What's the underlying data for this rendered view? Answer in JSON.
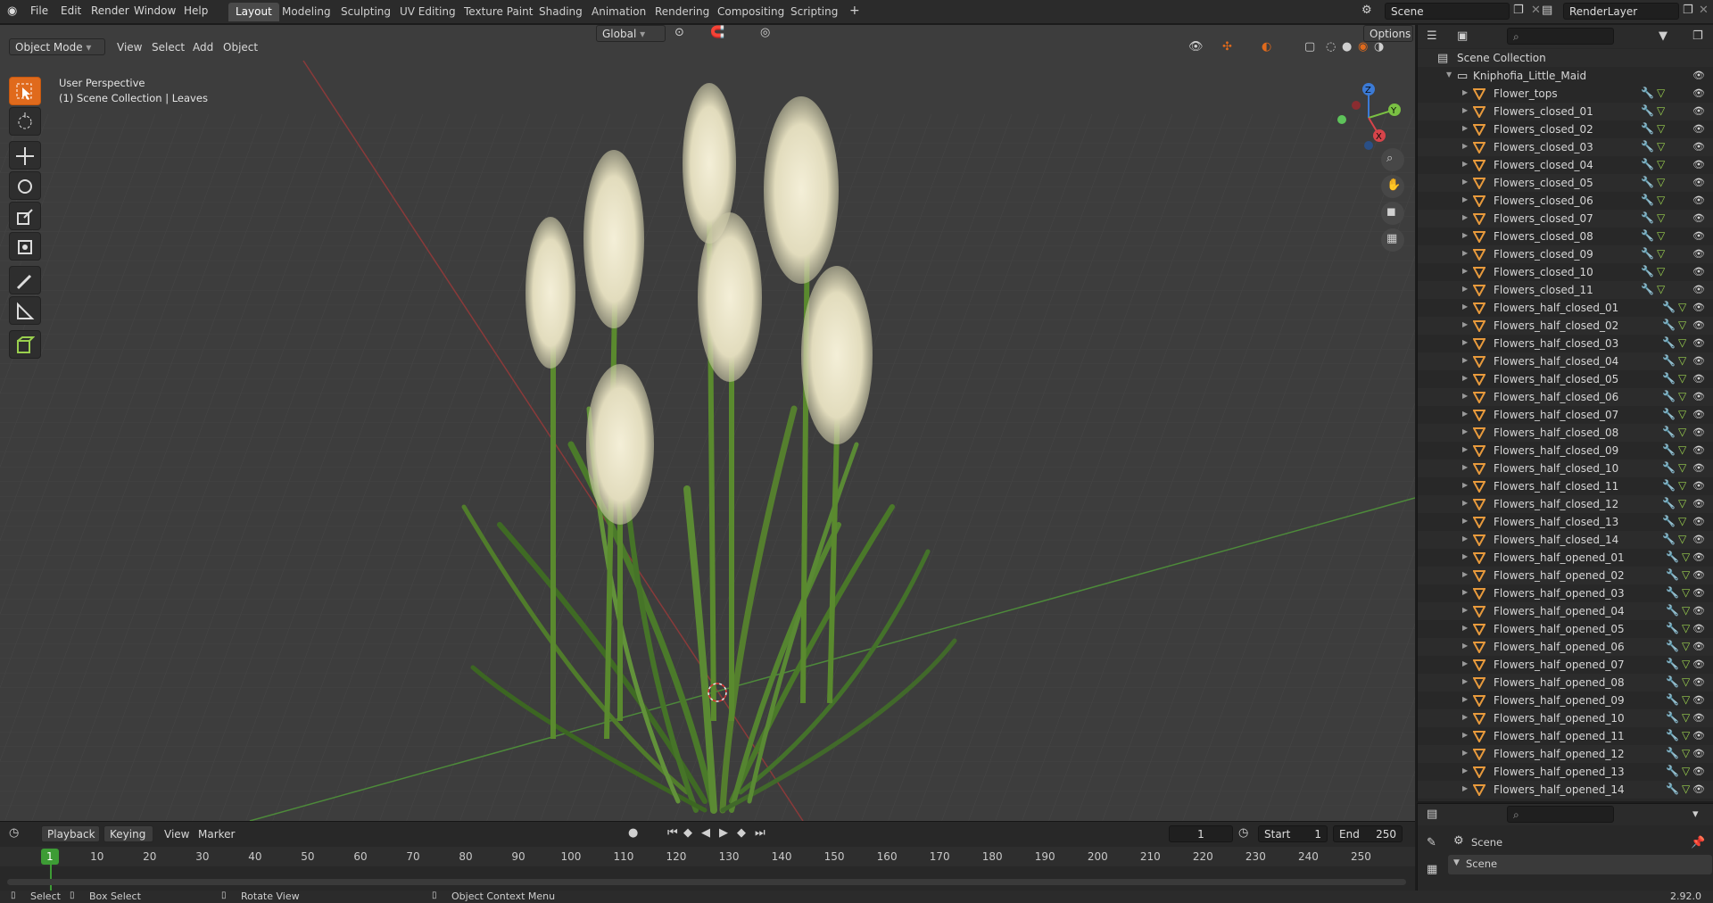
{
  "topbar": {
    "menus": [
      "File",
      "Edit",
      "Render",
      "Window",
      "Help"
    ],
    "workspaces": [
      "Layout",
      "Modeling",
      "Sculpting",
      "UV Editing",
      "Texture Paint",
      "Shading",
      "Animation",
      "Rendering",
      "Compositing",
      "Scripting"
    ],
    "active_workspace": "Layout",
    "add_tab": "+",
    "scene_name": "Scene",
    "render_layer": "RenderLayer"
  },
  "viewport_header": {
    "mode": "Object Mode",
    "menus": [
      "View",
      "Select",
      "Add",
      "Object"
    ],
    "transform_orientation": "Global",
    "options": "Options"
  },
  "viewport": {
    "perspective": "User Perspective",
    "context": "(1) Scene Collection | Leaves",
    "gizmo": {
      "z": "Z",
      "y": "Y",
      "x": "X"
    }
  },
  "outliner": {
    "root": "Scene Collection",
    "collection": "Kniphofia_Little_Maid",
    "items": [
      "Flower_tops",
      "Flowers_closed_01",
      "Flowers_closed_02",
      "Flowers_closed_03",
      "Flowers_closed_04",
      "Flowers_closed_05",
      "Flowers_closed_06",
      "Flowers_closed_07",
      "Flowers_closed_08",
      "Flowers_closed_09",
      "Flowers_closed_10",
      "Flowers_closed_11",
      "Flowers_half_closed_01",
      "Flowers_half_closed_02",
      "Flowers_half_closed_03",
      "Flowers_half_closed_04",
      "Flowers_half_closed_05",
      "Flowers_half_closed_06",
      "Flowers_half_closed_07",
      "Flowers_half_closed_08",
      "Flowers_half_closed_09",
      "Flowers_half_closed_10",
      "Flowers_half_closed_11",
      "Flowers_half_closed_12",
      "Flowers_half_closed_13",
      "Flowers_half_closed_14",
      "Flowers_half_opened_01",
      "Flowers_half_opened_02",
      "Flowers_half_opened_03",
      "Flowers_half_opened_04",
      "Flowers_half_opened_05",
      "Flowers_half_opened_06",
      "Flowers_half_opened_07",
      "Flowers_half_opened_08",
      "Flowers_half_opened_09",
      "Flowers_half_opened_10",
      "Flowers_half_opened_11",
      "Flowers_half_opened_12",
      "Flowers_half_opened_13",
      "Flowers_half_opened_14"
    ]
  },
  "properties": {
    "scene_label": "Scene",
    "scene_panel": "Scene"
  },
  "timeline": {
    "menus": [
      "Playback",
      "Keying",
      "View",
      "Marker"
    ],
    "current_frame": "1",
    "start_label": "Start",
    "start": "1",
    "end_label": "End",
    "end": "250",
    "ticks": [
      "1",
      "10",
      "20",
      "30",
      "40",
      "50",
      "60",
      "70",
      "80",
      "90",
      "100",
      "110",
      "120",
      "130",
      "140",
      "150",
      "160",
      "170",
      "180",
      "190",
      "200",
      "210",
      "220",
      "230",
      "240",
      "250"
    ]
  },
  "statusbar": {
    "select": "Select",
    "box_select": "Box Select",
    "rotate_view": "Rotate View",
    "context_menu": "Object Context Menu",
    "version": "2.92.0"
  },
  "colors": {
    "accent": "#e06a1c",
    "active_frame": "#3d9c35",
    "mesh": "#9ad04e",
    "modifier": "#6fa0e0"
  }
}
